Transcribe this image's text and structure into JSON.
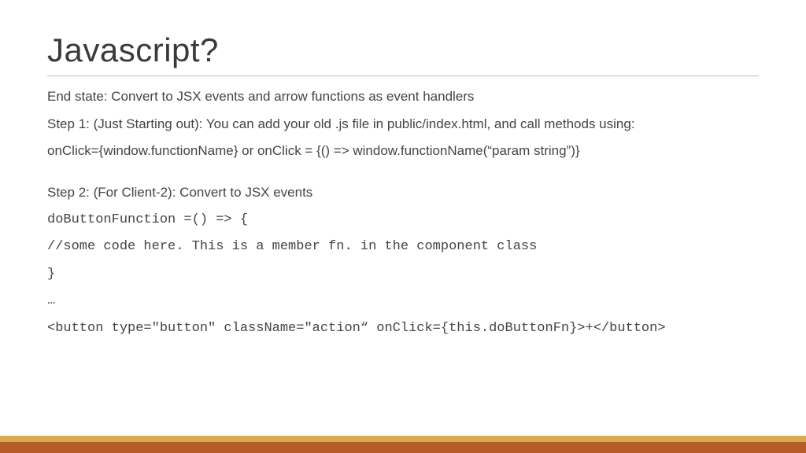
{
  "slide": {
    "title": "Javascript?",
    "lines": {
      "l1": "End state: Convert to JSX events and arrow functions as event handlers",
      "l2": "Step 1: (Just Starting out): You can add your old .js file in public/index.html, and call methods using:",
      "l3": "onClick={window.functionName} or onClick = {() => window.functionName(“param string”)}",
      "l4": "Step 2: (For Client-2): Convert to JSX events",
      "code1": "doButtonFunction =() => {",
      "code2": "//some code here.  This is a member fn. in the component class",
      "code3": "}",
      "code4": "…",
      "code5": "<button type=\"button\" className=\"action“ onClick={this.doButtonFn}>+</button>"
    }
  },
  "colors": {
    "accent_top": "#d9a94a",
    "accent_bottom": "#b85a2a",
    "code": "#4e8f3e"
  }
}
